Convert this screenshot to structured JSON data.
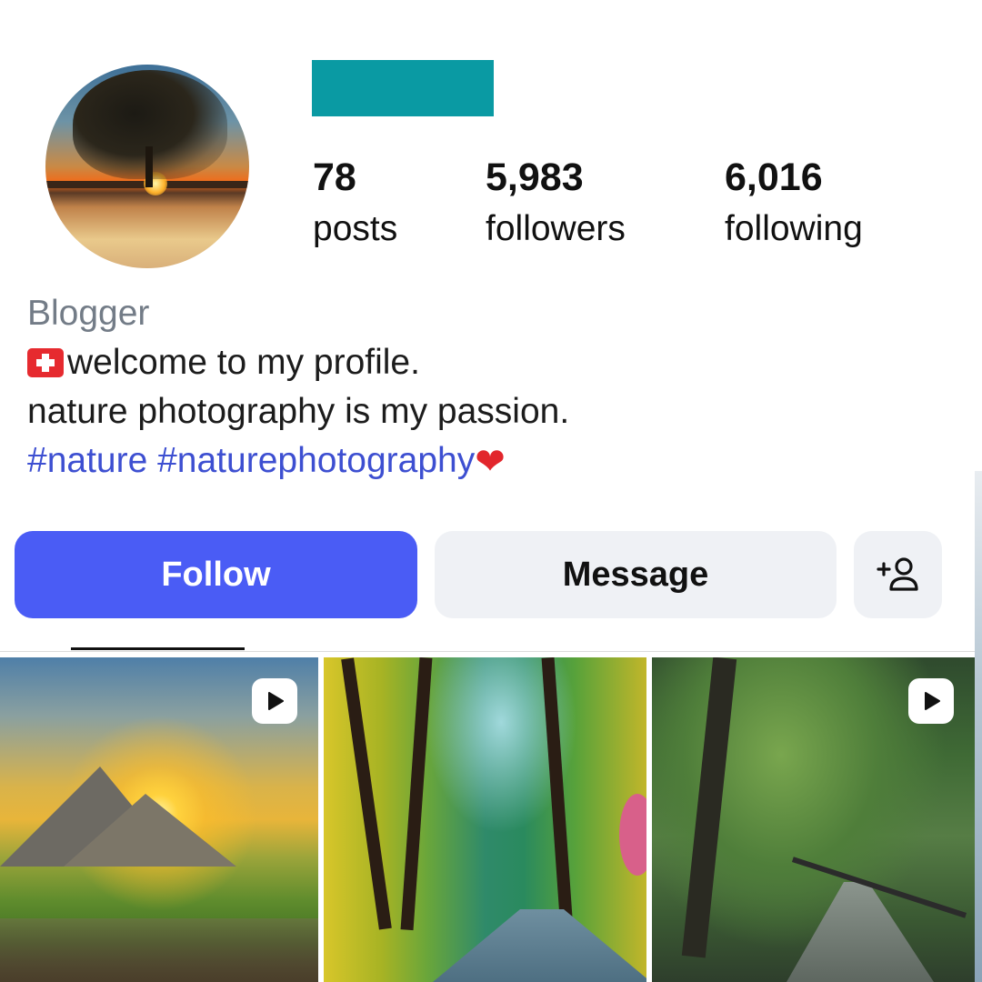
{
  "profile": {
    "stats": [
      {
        "value": "78",
        "label": "posts"
      },
      {
        "value": "5,983",
        "label": "followers"
      },
      {
        "value": "6,016",
        "label": "following"
      }
    ],
    "bio": {
      "category": "Blogger",
      "line1": "welcome to my profile.",
      "line2": "nature photography is my passion.",
      "hashtags": "#nature #naturephotography",
      "flag_icon": "swiss-flag-icon",
      "heart_icon": "red-heart-icon"
    }
  },
  "actions": {
    "follow_label": "Follow",
    "message_label": "Message",
    "add_user_icon": "add-user-icon"
  },
  "grid": {
    "posts": [
      {
        "subject": "mountain sunset over village",
        "is_video": true
      },
      {
        "subject": "colorful forest road",
        "is_video": false
      },
      {
        "subject": "rainy forest path with fence",
        "is_video": true
      }
    ]
  },
  "colors": {
    "accent": "#4a5cf5",
    "hashtag": "#3d4fd1",
    "username_redaction": "#0a9aa3",
    "secondary_button": "#eff1f5",
    "category_text": "#737c87"
  }
}
